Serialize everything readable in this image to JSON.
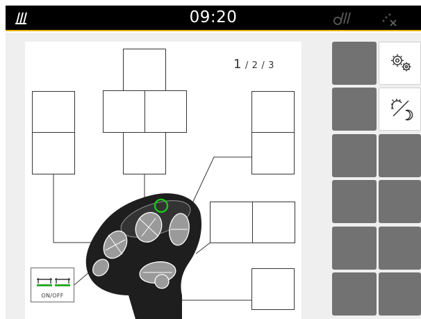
{
  "statusbar": {
    "time": "09:20",
    "left_icon": "machine-signal-icon",
    "mid_icon": "connection-inactive-icon",
    "right_icon": "gps-disabled-icon"
  },
  "joystick_page": {
    "page_current": "1",
    "page_sep1": "/",
    "page_two": "2",
    "page_sep2": "/",
    "page_three": "3"
  },
  "onoff_button": {
    "label": "ON/OFF",
    "icon": "sprayer-boom-icon"
  },
  "softkeys": {
    "settings_icon": "gears-icon",
    "daynight_icon": "day-night-icon"
  }
}
